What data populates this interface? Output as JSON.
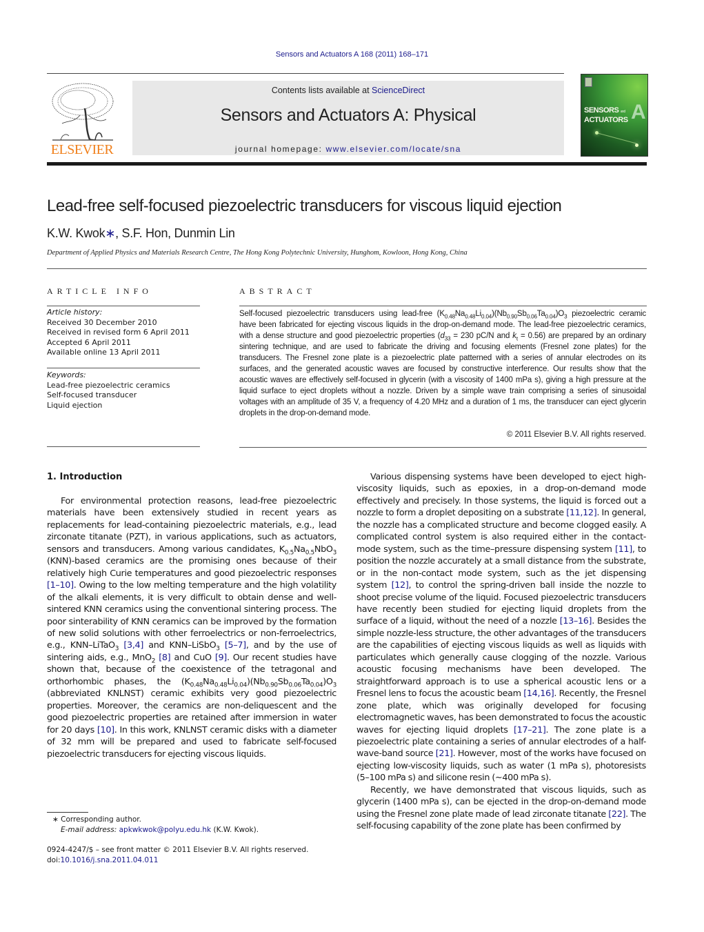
{
  "header": {
    "running_head": "Sensors and Actuators A 168 (2011) 168–171",
    "contents_prefix": "Contents lists available at ",
    "contents_link": "ScienceDirect",
    "journal_title": "Sensors and Actuators A: Physical",
    "homepage_prefix": "journal homepage: ",
    "homepage_link": "www.elsevier.com/locate/sna",
    "publisher_logo_text": "ELSEVIER",
    "cover": {
      "title_line1": "SENSORS",
      "title_and": "and",
      "title_line2": "ACTUATORS",
      "letter": "A",
      "colors": {
        "dark": "#0f2f14",
        "mid": "#3e9e3a",
        "light": "#7fd04a"
      }
    },
    "colors": {
      "link": "#1a1a8c",
      "elsevier_orange": "#f07f1a",
      "box_gray": "#e8e8e8"
    }
  },
  "article": {
    "title": "Lead-free self-focused piezoelectric transducers for viscous liquid ejection",
    "authors_part1": "K.W. Kwok",
    "author_mark": "∗",
    "authors_part2": ", S.F. Hon, Dunmin Lin",
    "affiliation": "Department of Applied Physics and Materials Research Centre, The Hong Kong Polytechnic University, Hunghom, Kowloon, Hong Kong, China"
  },
  "article_info": {
    "heading": "ARTICLE INFO",
    "history_label": "Article history:",
    "history": [
      "Received 30 December 2010",
      "Received in revised form 6 April 2011",
      "Accepted 6 April 2011",
      "Available online 13 April 2011"
    ],
    "keywords_label": "Keywords:",
    "keywords": [
      "Lead-free piezoelectric ceramics",
      "Self-focused transducer",
      "Liquid ejection"
    ]
  },
  "abstract": {
    "heading": "ABSTRACT",
    "s1": "Self-focused piezoelectric transducers using lead-free (K",
    "s2": "Na",
    "s3": "Li",
    "s4": ")(Nb",
    "s5": "Sb",
    "s6": "Ta",
    "s7": ")O",
    "s8": " piezoelectric ceramic have been fabricated for ejecting viscous liquids in the drop-on-demand mode. The lead-free piezoelectric ceramics, with a dense structure and good piezoelectric properties (",
    "d33_sym": "d",
    "d33_sub": "33",
    "s9": " = 230 pC/N and ",
    "kt_sym": "k",
    "kt_sub": "t",
    "s10": " = 0.56) are prepared by an ordinary sintering technique, and are used to fabricate the driving and focusing elements (Fresnel zone plates) for the transducers. The Fresnel zone plate is a piezoelectric plate patterned with a series of annular electrodes on its surfaces, and the generated acoustic waves are focused by constructive interference. Our results show that the acoustic waves are effectively self-focused in glycerin (with a viscosity of 1400 mPa s), giving a high pressure at the liquid surface to eject droplets without a nozzle. Driven by a simple wave train comprising a series of sinusoidal voltages with an amplitude of 35 V, a frequency of 4.20 MHz and a duration of 1 ms, the transducer can eject glycerin droplets in the drop-on-demand mode.",
    "sub_048a": "0.48",
    "sub_048b": "0.48",
    "sub_004a": "0.04",
    "sub_090": "0.90",
    "sub_006": "0.06",
    "sub_004b": "0.04",
    "sub_3": "3",
    "copyright": "© 2011 Elsevier B.V. All rights reserved."
  },
  "intro": {
    "heading": "1.  Introduction",
    "p1_a": "For environmental protection reasons, lead-free piezoelectric materials have been extensively studied in recent years as replacements for lead-containing piezoelectric materials, e.g., lead zirconate titanate (PZT), in various applications, such as actuators, sensors and transducers. Among various candidates, K",
    "p1_sub05a": "0.5",
    "p1_b": "Na",
    "p1_sub05b": "0.5",
    "p1_c": "NbO",
    "p1_sub3": "3",
    "p1_d": " (KNN)-based ceramics are the promising ones because of their relatively high Curie temperatures and good piezoelectric responses ",
    "ref_1_10": "[1–10]",
    "p1_e": ". Owing to the low melting temperature and the high volatility of the alkali elements, it is very difficult to obtain dense and well-sintered KNN ceramics using the conventional sintering process. The poor sinterability of KNN ceramics can be improved by the formation of new solid solutions with other ferroelectrics or non-ferroelectrics, e.g., KNN–LiTaO",
    "p1_sub3b": "3",
    "ref_3_4": "[3,4]",
    "p1_f": " and KNN–LiSbO",
    "p1_sub3c": "3",
    "ref_5_7": "[5–7]",
    "p1_g": ", and by the use of sintering aids, e.g., MnO",
    "p1_sub2": "2",
    "ref_8": "[8]",
    "p1_h": " and CuO ",
    "ref_9": "[9]",
    "p1_i": ". Our recent studies have shown that, because of the coexistence of the tetragonal and orthorhombic phases, the (K",
    "p1_j": "Na",
    "p1_k": "Li",
    "p1_l": ")(Nb",
    "p1_m": "Sb",
    "p1_n": "Ta",
    "p1_o": ")O",
    "p1_p": " (abbreviated KNLNST) ceramic exhibits very good piezoelectric properties. Moreover, the ceramics are non-deliquescent and the good piezoelectric properties are retained after immersion in water for 20 days ",
    "ref_10": "[10]",
    "p1_q": ". In this work, KNLNST ceramic disks with a diameter of 32 mm will be prepared and used to fabricate self-focused piezoelectric transducers for ejecting viscous liquids.",
    "p2_a": "Various dispensing systems have been developed to eject high-viscosity liquids, such as epoxies, in a drop-on-demand mode effectively and precisely. In those systems, the liquid is forced out a nozzle to form a droplet depositing on a substrate ",
    "ref_11_12": "[11,12]",
    "p2_b": ". In general, the nozzle has a complicated structure and become clogged easily. A complicated control system is also required either in the contact-mode system, such as the time–pressure dispensing system ",
    "ref_11": "[11]",
    "p2_c": ", to position the nozzle accurately at a small distance from the substrate, or in the non-contact mode system, such as the jet dispensing system ",
    "ref_12": "[12]",
    "p2_d": ", to control the spring-driven ball inside the nozzle to shoot precise volume of the liquid. Focused piezoelectric transducers have recently been studied for ejecting liquid droplets from the surface of a liquid, without the need of a nozzle ",
    "ref_13_16": "[13–16]",
    "p2_e": ". Besides the simple nozzle-less structure, the other advantages of the transducers are the capabilities of ejecting viscous liquids as well as liquids with particulates which generally cause clogging of the nozzle. Various acoustic focusing mechanisms have been developed. The straightforward approach is to use a spherical acoustic lens or a Fresnel lens to focus the acoustic beam ",
    "ref_14_16": "[14,16]",
    "p2_f": ". Recently, the Fresnel zone plate, which was originally developed for focusing electromagnetic waves, has been demonstrated to focus the acoustic waves for ejecting liquid droplets ",
    "ref_17_21": "[17–21]",
    "p2_g": ". The zone plate is a piezoelectric plate containing a series of annular electrodes of a half-wave-band source ",
    "ref_21": "[21]",
    "p2_h": ". However, most of the works have focused on ejecting low-viscosity liquids, such as water (1 mPa s), photoresists (5–100 mPa s) and silicone resin (∼400 mPa s).",
    "p3_a": "Recently, we have demonstrated that viscous liquids, such as glycerin (1400 mPa s), can be ejected in the drop-on-demand mode using the Fresnel zone plate made of lead zirconate titanate ",
    "ref_22": "[22]",
    "p3_b": ". The self-focusing capability of the zone plate has been confirmed by"
  },
  "footnotes": {
    "corresponding": "∗  Corresponding author.",
    "email_label": "E-mail address: ",
    "email": "apkwkwok@polyu.edu.hk",
    "email_suffix": " (K.W. Kwok).",
    "front_matter": "0924-4247/$ – see front matter © 2011 Elsevier B.V. All rights reserved.",
    "doi_prefix": "doi:",
    "doi": "10.1016/j.sna.2011.04.011"
  }
}
